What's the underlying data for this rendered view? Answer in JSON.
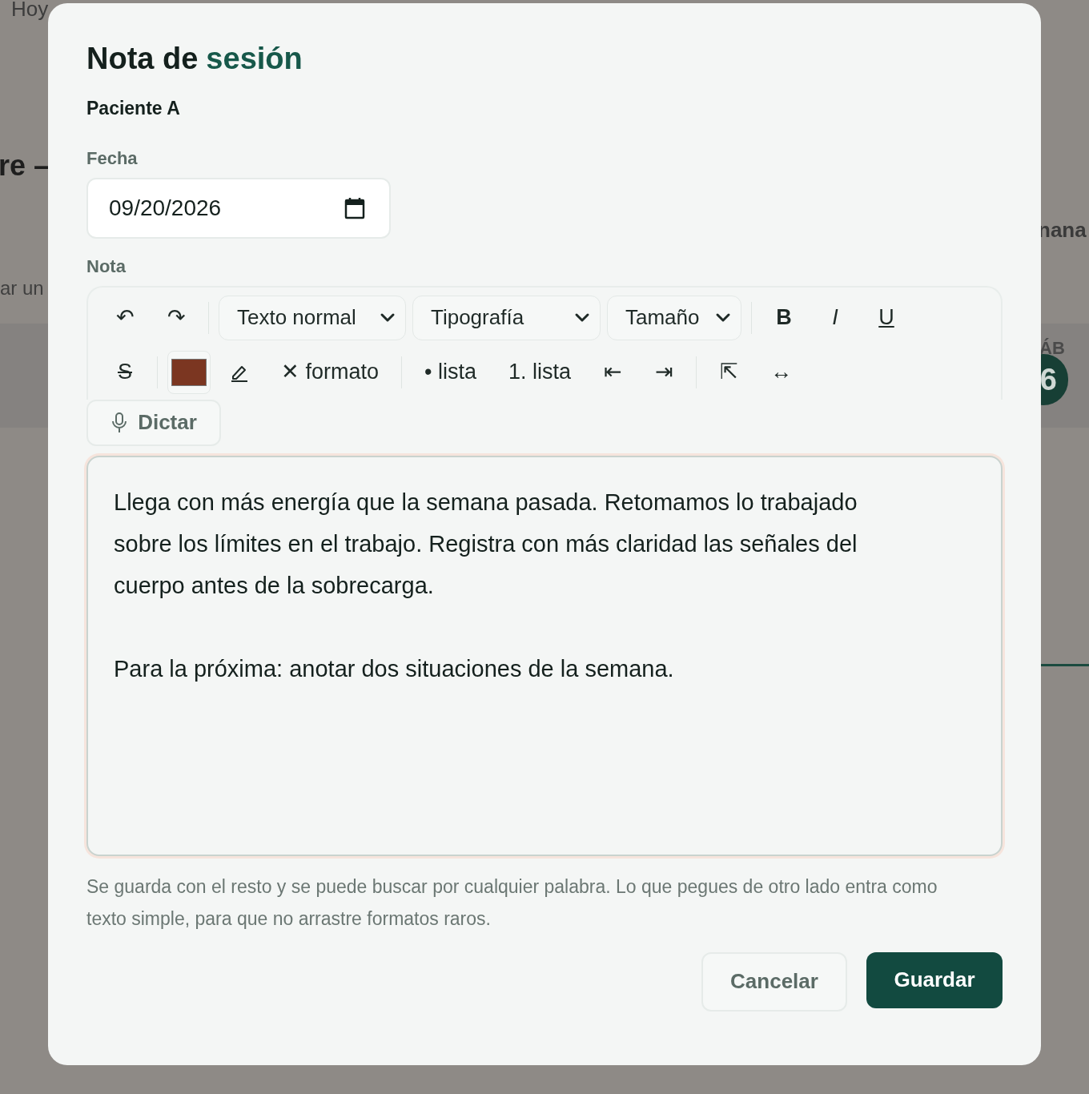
{
  "background": {
    "nav_item": "Hoy",
    "heading_fragment": "re –",
    "text_fragment": "ar un",
    "week_fragment": "nana",
    "day_label": "ÁB",
    "day_number": "6"
  },
  "dialog": {
    "title": "Nota de",
    "title_accent": "sesión",
    "patient": "Paciente A",
    "date_label": "Fecha",
    "date_value": "09/20/2026",
    "note_label": "Nota",
    "toolbar_rows": [
      [
        {
          "kind": "button",
          "label": "↶"
        },
        {
          "kind": "button",
          "label": "↷"
        },
        {
          "kind": "divider"
        },
        {
          "kind": "select",
          "label": "Texto normal"
        },
        {
          "kind": "select",
          "label": "Tipografía"
        },
        {
          "kind": "select",
          "label": "Tamaño"
        },
        {
          "kind": "divider"
        },
        {
          "kind": "bold",
          "label": "B"
        },
        {
          "kind": "italic",
          "label": "I"
        },
        {
          "kind": "underline",
          "label": "U"
        }
      ],
      [
        {
          "kind": "strike",
          "label": "S"
        },
        {
          "kind": "divider"
        },
        {
          "kind": "color",
          "color": "#7b3621"
        },
        {
          "kind": "highlight"
        },
        {
          "kind": "button",
          "label": "✕ formato"
        },
        {
          "kind": "divider"
        },
        {
          "kind": "button",
          "label": "• lista"
        },
        {
          "kind": "button",
          "label": "1. lista"
        },
        {
          "kind": "button",
          "label": "⇤"
        },
        {
          "kind": "button",
          "label": "⇥"
        },
        {
          "kind": "divider"
        },
        {
          "kind": "button",
          "label": "⇱"
        },
        {
          "kind": "small",
          "label": "↔"
        }
      ]
    ],
    "dictate": "Dictar",
    "paragraphs": [
      "Llega con más energía que la semana pasada. Retomamos lo trabajado sobre los límites en el trabajo. Registra con más claridad las señales del cuerpo antes de la sobrecarga.",
      "Para la próxima: anotar dos situaciones de la semana."
    ],
    "helper": "Se guarda con el resto y se puede buscar por cualquier palabra. Lo que pegues de otro lado entra como texto simple, para que no arrastre formatos raros.",
    "buttons": [
      {
        "kind": "secondary",
        "label": "Cancelar"
      },
      {
        "kind": "primary",
        "label": "Guardar"
      }
    ]
  }
}
